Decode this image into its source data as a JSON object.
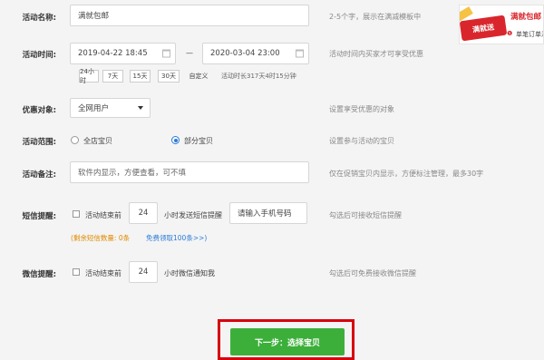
{
  "name_row": {
    "label": "活动名称:",
    "value": "满就包邮",
    "hint": "2-5个字，展示在满减模板中"
  },
  "time_row": {
    "label": "活动时间:",
    "start": "2019-04-22 18:45",
    "separator": "—",
    "end": "2020-03-04 23:00",
    "hint": "活动时间内买家才可享受优惠",
    "presets": [
      "24小时",
      "7天",
      "15天",
      "30天",
      "自定义"
    ],
    "duration": "活动时长317天4时15分钟"
  },
  "target_row": {
    "label": "优惠对象:",
    "selected": "全网用户",
    "hint": "设置享受优惠的对象"
  },
  "scope_row": {
    "label": "活动范围:",
    "option_all": "全店宝贝",
    "option_partial": "部分宝贝",
    "selected": "部分宝贝",
    "hint": "设置参与活动的宝贝"
  },
  "note_row": {
    "label": "活动备注:",
    "placeholder": "软件内显示，方便查看，可不填",
    "hint": "仅在促销宝贝内显示，方便标注管理，最多30字"
  },
  "sms_row": {
    "label": "短信提醒:",
    "check_text": "活动结束前",
    "hours": "24",
    "after_text": "小时发送短信提醒",
    "phone_button": "请输入手机号码",
    "hint": "勾选后可接收短信提醒",
    "remaining": "(剩余短信数量: 0条",
    "free_link": "免费领取100条>>)"
  },
  "wechat_row": {
    "label": "微信提醒:",
    "check_text": "活动结束前",
    "hours": "24",
    "after_text": "小时微信通知我",
    "hint": "勾选后可免费接收微信提醒"
  },
  "promo": {
    "title": "满就包邮",
    "tag_text": "满就送",
    "sub_text": "单笔订单满"
  },
  "submit": {
    "label": "下一步：选择宝贝"
  },
  "colors": {
    "accent_green": "#3caf3b",
    "highlight_red": "#d9000d",
    "link_blue": "#2a7bd8",
    "warn_orange": "#e08a00"
  }
}
